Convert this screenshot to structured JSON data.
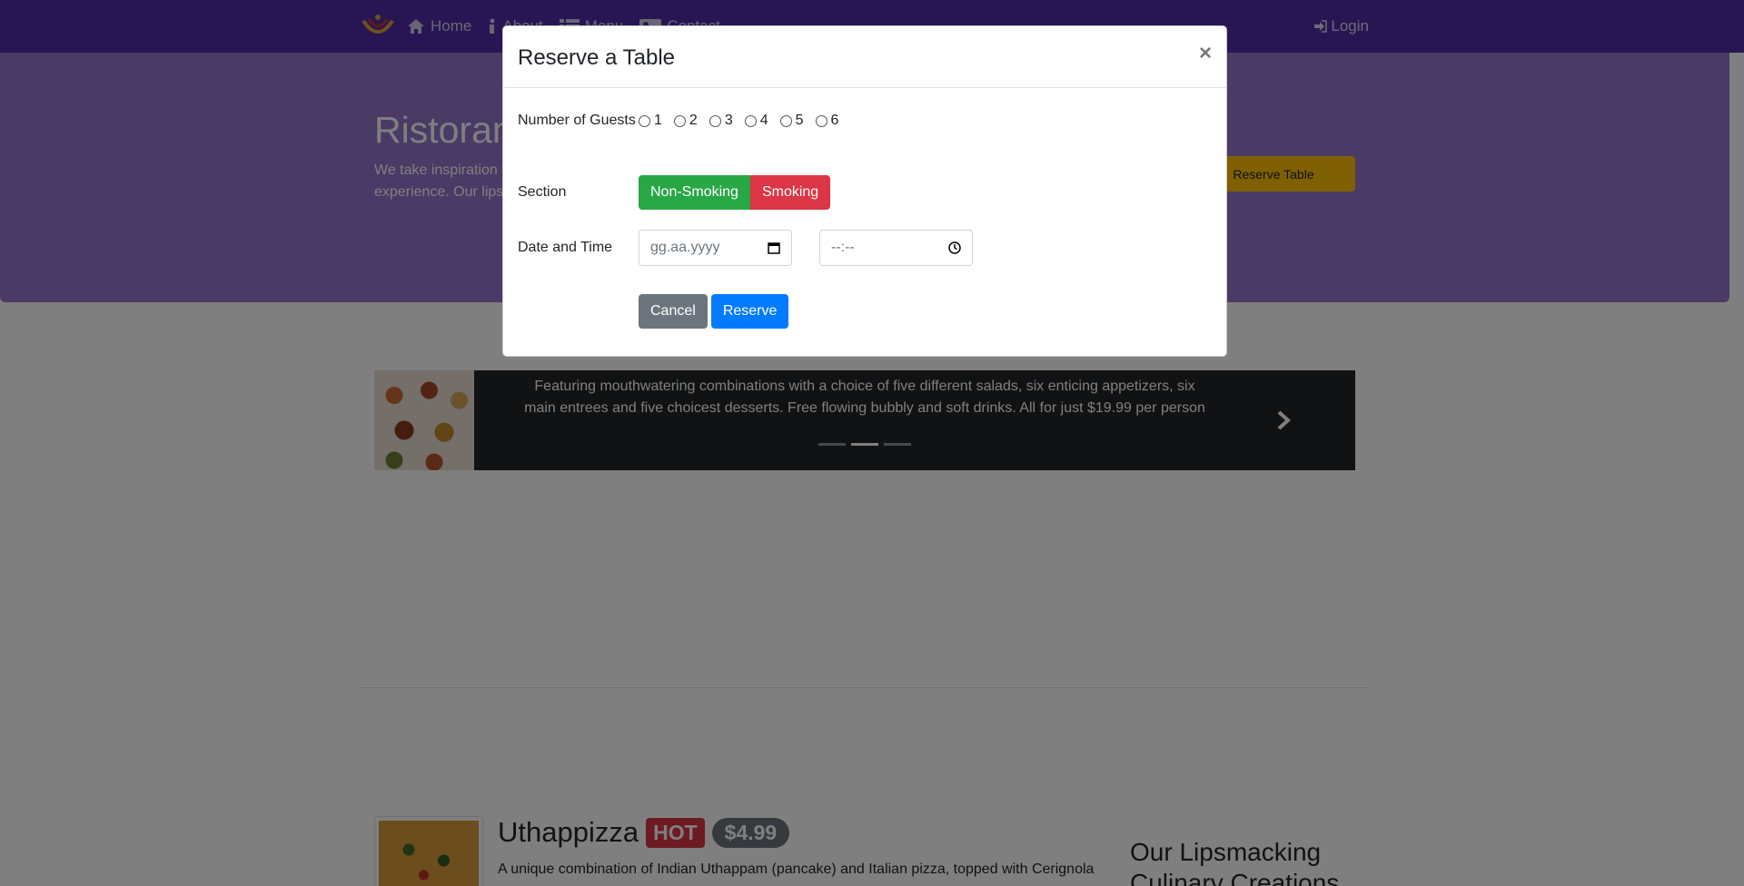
{
  "nav": {
    "items": [
      {
        "label": "Home",
        "icon": "home-icon"
      },
      {
        "label": "About",
        "icon": "info-icon"
      },
      {
        "label": "Menu",
        "icon": "list-icon"
      },
      {
        "label": "Contact",
        "icon": "address-card-icon"
      }
    ],
    "login_label": "Login"
  },
  "jumbotron": {
    "title": "Ristorante con Fusion",
    "text": "We take inspiration from the World's best cuisines, and create a unique fusion experience. Our lipsmacking creations will tickle your culinary senses!",
    "reserve_button": "Reserve Table"
  },
  "carousel": {
    "caption": "Featuring mouthwatering combinations with a choice of five different salads, six enticing appetizers, six main entrees and five choicest desserts. Free flowing bubbly and soft drinks. All for just $19.99 per person"
  },
  "featured": {
    "name": "Uthappizza",
    "badge": "HOT",
    "price": "$4.99",
    "description": "A unique combination of Indian Uthappam (pancake) and Italian pizza, topped with Cerignola",
    "side_title": "Our Lipsmacking Culinary Creations"
  },
  "modal": {
    "title": "Reserve a Table",
    "close": "×",
    "guests_label": "Number of Guests",
    "guest_options": [
      "1",
      "2",
      "3",
      "4",
      "5",
      "6"
    ],
    "section_label": "Section",
    "section_options": [
      "Non-Smoking",
      "Smoking"
    ],
    "datetime_label": "Date and Time",
    "date_placeholder": "gg.aa.yyyy",
    "time_placeholder": "--:--",
    "cancel_label": "Cancel",
    "reserve_label": "Reserve"
  },
  "colors": {
    "navbar": "#512da8",
    "jumbotron": "#9575cd",
    "success": "#28a745",
    "danger": "#dc3545",
    "primary": "#007bff",
    "secondary": "#6c757d",
    "warning": "#ffc107"
  }
}
